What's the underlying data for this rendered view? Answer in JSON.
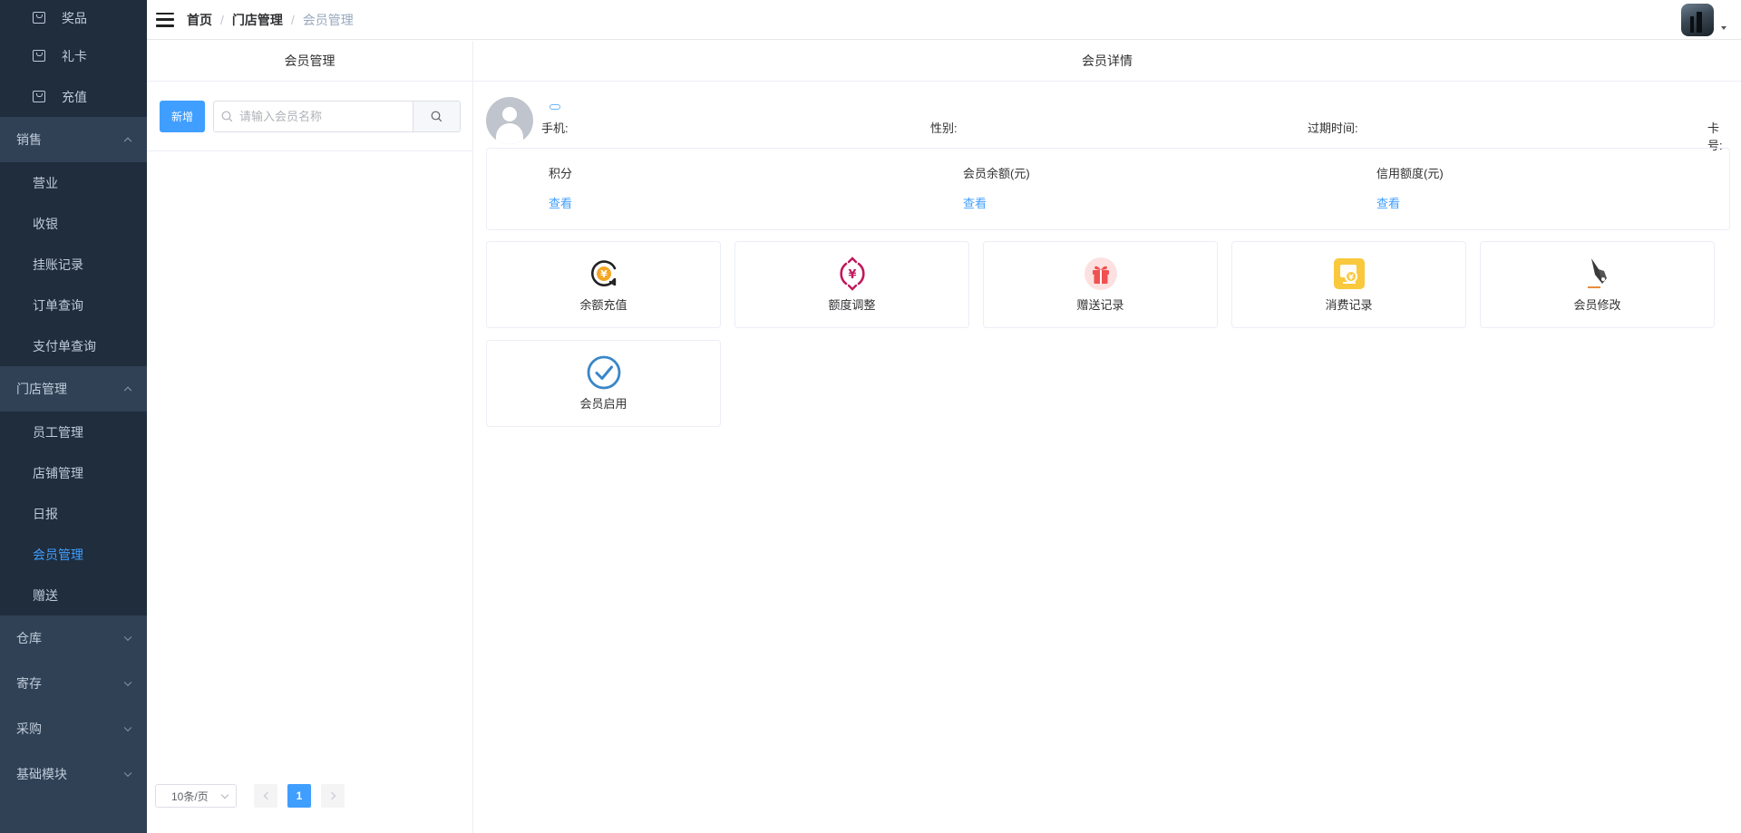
{
  "sidebar": {
    "items": [
      {
        "label": "奖品",
        "kind": "leaf-icon"
      },
      {
        "label": "礼卡",
        "kind": "leaf-icon"
      },
      {
        "label": "充值",
        "kind": "leaf-icon"
      },
      {
        "label": "销售",
        "kind": "group",
        "expanded": true
      },
      {
        "label": "营业",
        "kind": "leaf"
      },
      {
        "label": "收银",
        "kind": "leaf"
      },
      {
        "label": "挂账记录",
        "kind": "leaf"
      },
      {
        "label": "订单查询",
        "kind": "leaf"
      },
      {
        "label": "支付单查询",
        "kind": "leaf"
      },
      {
        "label": "门店管理",
        "kind": "group",
        "expanded": true
      },
      {
        "label": "员工管理",
        "kind": "leaf"
      },
      {
        "label": "店铺管理",
        "kind": "leaf"
      },
      {
        "label": "日报",
        "kind": "leaf"
      },
      {
        "label": "会员管理",
        "kind": "leaf",
        "active": true
      },
      {
        "label": "赠送",
        "kind": "leaf"
      },
      {
        "label": "仓库",
        "kind": "group",
        "expanded": false
      },
      {
        "label": "寄存",
        "kind": "group",
        "expanded": false
      },
      {
        "label": "采购",
        "kind": "group",
        "expanded": false
      },
      {
        "label": "基础模块",
        "kind": "group",
        "expanded": false
      }
    ]
  },
  "header": {
    "breadcrumb": [
      "首页",
      "门店管理",
      "会员管理"
    ],
    "separator": "/"
  },
  "left": {
    "title": "会员管理",
    "add_label": "新增",
    "search_placeholder": "请输入会员名称",
    "page_size": "10条/页",
    "current_page": "1"
  },
  "right": {
    "title": "会员详情",
    "labels": {
      "phone": "手机:",
      "gender": "性别:",
      "expire": "过期时间:",
      "card": "卡号:"
    },
    "stats": [
      {
        "label": "积分",
        "link": "查看"
      },
      {
        "label": "会员余额(元)",
        "link": "查看"
      },
      {
        "label": "信用额度(元)",
        "link": "查看"
      }
    ],
    "actions": [
      {
        "label": "余额充值",
        "icon": "balance-recharge-icon"
      },
      {
        "label": "额度调整",
        "icon": "credit-adjust-icon"
      },
      {
        "label": "赠送记录",
        "icon": "gift-icon"
      },
      {
        "label": "消费记录",
        "icon": "consumption-record-icon"
      },
      {
        "label": "会员修改",
        "icon": "pen-nib-icon"
      },
      {
        "label": "会员启用",
        "icon": "check-circle-icon"
      }
    ]
  },
  "colors": {
    "sidebar_bg": "#304156",
    "sidebar_sub_bg": "#1f2d3d",
    "accent": "#409eff"
  }
}
